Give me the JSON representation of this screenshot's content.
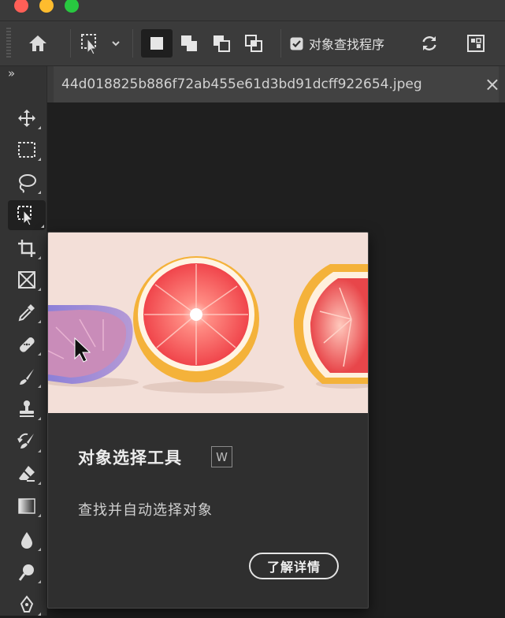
{
  "window": {
    "traffic_lights": {
      "close": "#ff5f57",
      "minimize": "#febc2e",
      "maximize": "#28c840"
    }
  },
  "options_bar": {
    "home_icon": "home-icon",
    "tool_preset_icon": "object-selection-preset-icon",
    "selection_modes": [
      "new-selection-icon",
      "add-to-selection-icon",
      "subtract-from-selection-icon",
      "intersect-selection-icon"
    ],
    "object_finder_label": "对象查找程序",
    "object_finder_checked": true,
    "refresh_icon": "refresh-icon",
    "show_objects_icon": "show-all-objects-icon"
  },
  "panel_collapse_label": "»",
  "document_tab": {
    "filename": "44d018825b886f72ab455e61d3bd91dcff922654.jpeg",
    "close_icon": "×"
  },
  "tools": [
    {
      "name": "move-tool-icon"
    },
    {
      "name": "marquee-tool-icon"
    },
    {
      "name": "lasso-tool-icon"
    },
    {
      "name": "object-selection-tool-icon",
      "selected": true
    },
    {
      "name": "crop-tool-icon"
    },
    {
      "name": "frame-tool-icon"
    },
    {
      "name": "eyedropper-tool-icon"
    },
    {
      "name": "healing-brush-tool-icon"
    },
    {
      "name": "brush-tool-icon"
    },
    {
      "name": "clone-stamp-tool-icon"
    },
    {
      "name": "history-brush-tool-icon"
    },
    {
      "name": "eraser-tool-icon"
    },
    {
      "name": "gradient-tool-icon"
    },
    {
      "name": "blur-tool-icon"
    },
    {
      "name": "dodge-tool-icon"
    },
    {
      "name": "pen-tool-icon"
    }
  ],
  "tooltip": {
    "title": "对象选择工具",
    "shortcut": "W",
    "description": "查找并自动选择对象",
    "learn_more": "了解详情"
  }
}
